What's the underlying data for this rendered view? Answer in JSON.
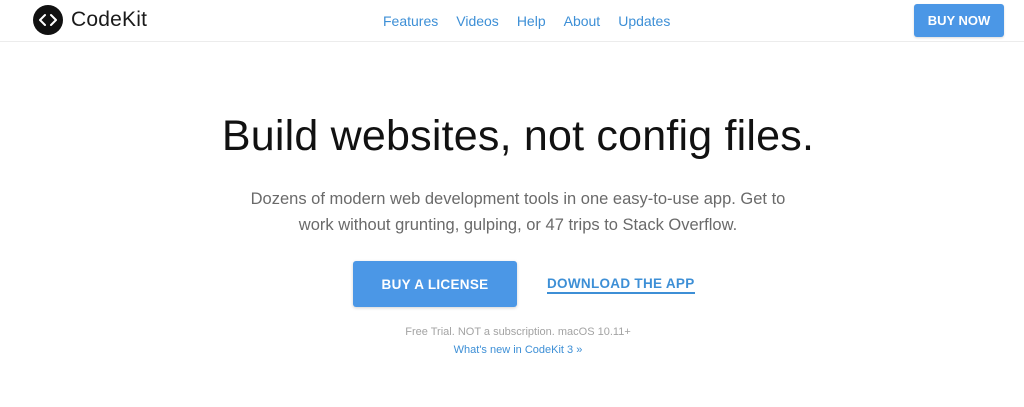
{
  "brand": {
    "name": "CodeKit",
    "logo_icon": "code-brackets-icon"
  },
  "nav": {
    "items": [
      {
        "label": "Features"
      },
      {
        "label": "Videos"
      },
      {
        "label": "Help"
      },
      {
        "label": "About"
      },
      {
        "label": "Updates"
      }
    ],
    "buy_now_label": "BUY NOW"
  },
  "hero": {
    "title": "Build websites, not config files.",
    "subtitle": "Dozens of modern web development tools in one easy-to-use app. Get to work without grunting, gulping, or 47 trips to Stack Overflow.",
    "buy_license_label": "BUY A LICENSE",
    "download_label": "DOWNLOAD THE APP",
    "trial_note": "Free Trial. NOT a subscription. macOS 10.11+",
    "whats_new_label": "What's new in CodeKit 3 »"
  },
  "colors": {
    "accent": "#4b97e6",
    "link": "#3d8fd6",
    "title_text": "#111111",
    "subtitle_text": "#6a6a6a",
    "muted_text": "#a3a3a3"
  }
}
